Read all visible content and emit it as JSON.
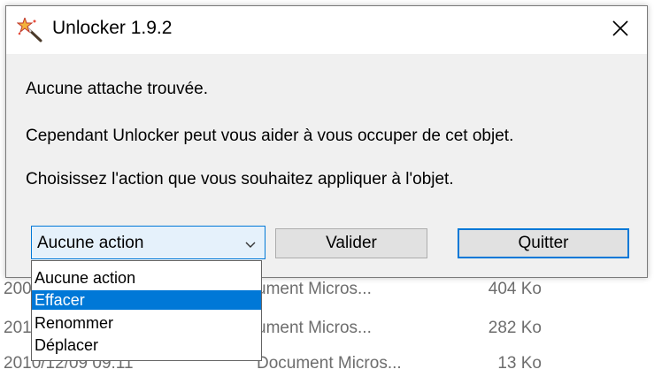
{
  "background_list": {
    "rows": [
      {
        "date": "200",
        "type": "ument Micros...",
        "size": "404 Ko"
      },
      {
        "date": "201",
        "type": "ument Micros...",
        "size": "282 Ko"
      },
      {
        "date": "2010/12/09 09:11",
        "type": "Document Micros...",
        "size": "13 Ko"
      }
    ]
  },
  "dialog": {
    "title": "Unlocker 1.9.2",
    "close_icon": "close-icon",
    "messages": [
      "Aucune attache trouvée.",
      "Cependant Unlocker peut vous aider à vous occuper de cet objet.",
      "Choisissez l'action que vous souhaitez appliquer à l'objet."
    ],
    "action_select": {
      "value": "Aucune action",
      "options": [
        "Aucune action",
        "Effacer",
        "Renommer",
        "Déplacer"
      ],
      "highlighted": "Effacer"
    },
    "buttons": {
      "validate": "Valider",
      "quit": "Quitter"
    }
  },
  "colors": {
    "accent": "#0078d7",
    "dialog_bg": "#f0f0f0",
    "combo_bg": "#e5f1fb"
  }
}
